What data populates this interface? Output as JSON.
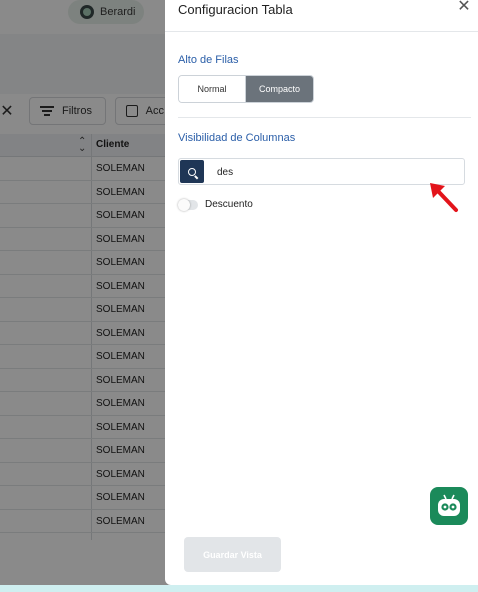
{
  "header": {
    "user_chip_label": "Berardi"
  },
  "toolbar": {
    "filters_label": "Filtros",
    "actions_label": "Acc"
  },
  "table": {
    "column_header": "Cliente",
    "rows": [
      "SOLEMAN",
      "SOLEMAN",
      "SOLEMAN",
      "SOLEMAN",
      "SOLEMAN",
      "SOLEMAN",
      "SOLEMAN",
      "SOLEMAN",
      "SOLEMAN",
      "SOLEMAN",
      "SOLEMAN",
      "SOLEMAN",
      "SOLEMAN",
      "SOLEMAN",
      "SOLEMAN",
      "SOLEMAN"
    ]
  },
  "panel": {
    "title": "Configuracion Tabla",
    "row_height_label": "Alto de Filas",
    "row_height_options": [
      "Normal",
      "Compacto"
    ],
    "row_height_selected": "Compacto",
    "column_visibility_label": "Visibilidad de Columnas",
    "search_value": "des",
    "columns": [
      {
        "label": "Descuento",
        "visible": false
      }
    ],
    "save_label": "Guardar Vista"
  },
  "colors": {
    "accent_blue": "#2a5ea8",
    "search_button": "#1f3656",
    "selected_segment": "#6b737b",
    "annotation_arrow": "#e3141b",
    "bot_green": "#1b8a5a"
  },
  "icons": [
    "globe-icon",
    "close-icon",
    "filters-icon",
    "actions-icon",
    "sort-icon",
    "search-icon",
    "annotation-arrow-icon",
    "robot-assistant-icon"
  ]
}
